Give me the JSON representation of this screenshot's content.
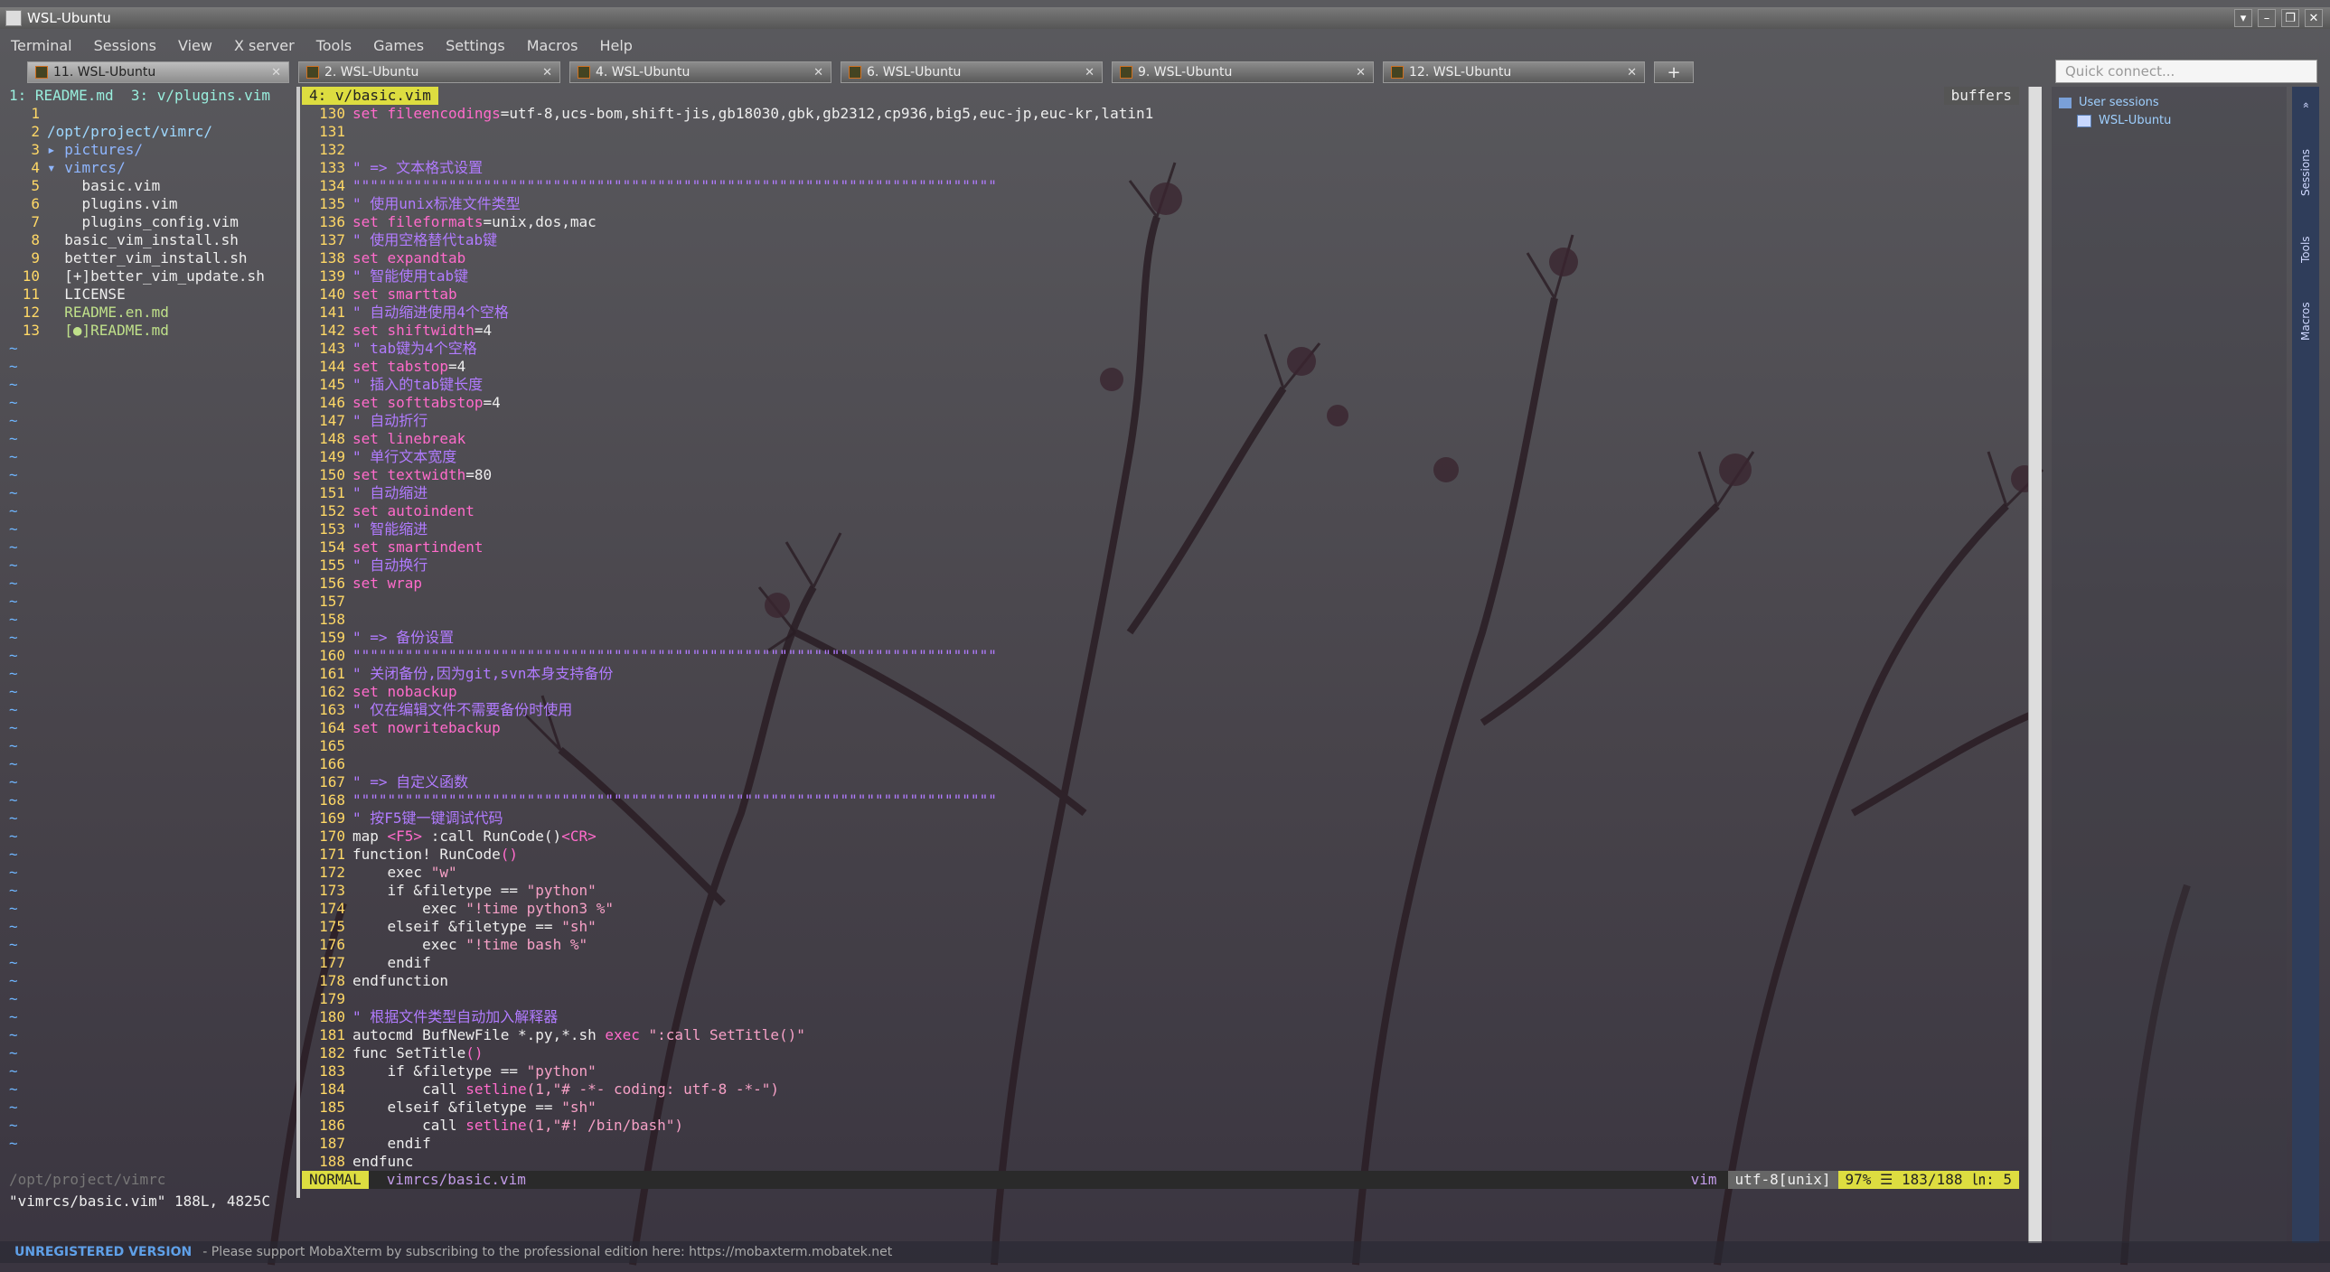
{
  "window": {
    "title": "WSL-Ubuntu",
    "controls": [
      "▾",
      "–",
      "❐",
      "✕"
    ]
  },
  "menu": [
    "Terminal",
    "Sessions",
    "View",
    "X server",
    "Tools",
    "Games",
    "Settings",
    "Macros",
    "Help"
  ],
  "tabs": [
    {
      "label": "11. WSL-Ubuntu",
      "active": true
    },
    {
      "label": "2. WSL-Ubuntu",
      "active": false
    },
    {
      "label": "4. WSL-Ubuntu",
      "active": false
    },
    {
      "label": "6. WSL-Ubuntu",
      "active": false
    },
    {
      "label": "9. WSL-Ubuntu",
      "active": false
    },
    {
      "label": "12. WSL-Ubuntu",
      "active": false
    }
  ],
  "quick_connect": {
    "placeholder": "Quick connect..."
  },
  "sidebar": {
    "section": "User sessions",
    "session": "WSL-Ubuntu",
    "vertical_tabs": [
      "Sessions",
      "Tools",
      "Macros"
    ]
  },
  "vim": {
    "top_buffers": "1: README.md  3: v/plugins.vim",
    "active_buffer": " 4: v/basic.vim ",
    "buffers_label": "buffers",
    "tree": [
      {
        "n": "1",
        "t": "",
        "c": ""
      },
      {
        "n": "2",
        "t": "/opt/project/vimrc/",
        "c": "head"
      },
      {
        "n": "3",
        "t": "▸ pictures/",
        "c": "dir"
      },
      {
        "n": "4",
        "t": "▾ vimrcs/",
        "c": "dir"
      },
      {
        "n": "5",
        "t": "    basic.vim",
        "c": ""
      },
      {
        "n": "6",
        "t": "    plugins.vim",
        "c": ""
      },
      {
        "n": "7",
        "t": "    plugins_config.vim",
        "c": ""
      },
      {
        "n": "8",
        "t": "  basic_vim_install.sh",
        "c": ""
      },
      {
        "n": "9",
        "t": "  better_vim_install.sh",
        "c": ""
      },
      {
        "n": "10",
        "t": "  [+]better_vim_update.sh",
        "c": ""
      },
      {
        "n": "11",
        "t": "  LICENSE",
        "c": ""
      },
      {
        "n": "12",
        "t": "  README.en.md",
        "c": "green"
      },
      {
        "n": "13",
        "t": "  [●]README.md",
        "c": "green"
      }
    ],
    "tree_status": "/opt/project/vimrc",
    "code": [
      {
        "n": "130",
        "s": [
          [
            "kw",
            "set "
          ],
          [
            "opt",
            "fileencodings"
          ],
          [
            "plain",
            "=utf-8,ucs-bom,shift-jis,gb18030,gbk,gb2312,cp936,big5,euc-jp,euc-kr,latin1"
          ]
        ]
      },
      {
        "n": "131",
        "s": []
      },
      {
        "n": "132",
        "s": []
      },
      {
        "n": "133",
        "s": [
          [
            "cm",
            "\" => 文本格式设置"
          ]
        ]
      },
      {
        "n": "134",
        "s": [
          [
            "dq",
            "\"\"\"\"\"\"\"\"\"\"\"\"\"\"\"\"\"\"\"\"\"\"\"\"\"\"\"\"\"\"\"\"\"\"\"\"\"\"\"\"\"\"\"\"\"\"\"\"\"\"\"\"\"\"\"\"\"\"\"\"\"\"\"\"\"\"\"\"\"\"\"\"\"\""
          ]
        ]
      },
      {
        "n": "135",
        "s": [
          [
            "cm",
            "\" 使用unix标准文件类型"
          ]
        ]
      },
      {
        "n": "136",
        "s": [
          [
            "kw",
            "set "
          ],
          [
            "opt",
            "fileformats"
          ],
          [
            "plain",
            "=unix,dos,mac"
          ]
        ]
      },
      {
        "n": "137",
        "s": [
          [
            "cm",
            "\" 使用空格替代tab键"
          ]
        ]
      },
      {
        "n": "138",
        "s": [
          [
            "kw",
            "set "
          ],
          [
            "opt",
            "expandtab"
          ]
        ]
      },
      {
        "n": "139",
        "s": [
          [
            "cm",
            "\" 智能使用tab键"
          ]
        ]
      },
      {
        "n": "140",
        "s": [
          [
            "kw",
            "set "
          ],
          [
            "opt",
            "smarttab"
          ]
        ]
      },
      {
        "n": "141",
        "s": [
          [
            "cm",
            "\" 自动缩进使用4个空格"
          ]
        ]
      },
      {
        "n": "142",
        "s": [
          [
            "kw",
            "set "
          ],
          [
            "opt",
            "shiftwidth"
          ],
          [
            "plain",
            "=4"
          ]
        ]
      },
      {
        "n": "143",
        "s": [
          [
            "cm",
            "\" tab键为4个空格"
          ]
        ]
      },
      {
        "n": "144",
        "s": [
          [
            "kw",
            "set "
          ],
          [
            "opt",
            "tabstop"
          ],
          [
            "plain",
            "=4"
          ]
        ]
      },
      {
        "n": "145",
        "s": [
          [
            "cm",
            "\" 插入的tab键长度"
          ]
        ]
      },
      {
        "n": "146",
        "s": [
          [
            "kw",
            "set "
          ],
          [
            "opt",
            "softtabstop"
          ],
          [
            "plain",
            "=4"
          ]
        ]
      },
      {
        "n": "147",
        "s": [
          [
            "cm",
            "\" 自动折行"
          ]
        ]
      },
      {
        "n": "148",
        "s": [
          [
            "kw",
            "set "
          ],
          [
            "opt",
            "linebreak"
          ]
        ]
      },
      {
        "n": "149",
        "s": [
          [
            "cm",
            "\" 单行文本宽度"
          ]
        ]
      },
      {
        "n": "150",
        "s": [
          [
            "kw",
            "set "
          ],
          [
            "opt",
            "textwidth"
          ],
          [
            "plain",
            "=80"
          ]
        ]
      },
      {
        "n": "151",
        "s": [
          [
            "cm",
            "\" 自动缩进"
          ]
        ]
      },
      {
        "n": "152",
        "s": [
          [
            "kw",
            "set "
          ],
          [
            "opt",
            "autoindent"
          ]
        ]
      },
      {
        "n": "153",
        "s": [
          [
            "cm",
            "\" 智能缩进"
          ]
        ]
      },
      {
        "n": "154",
        "s": [
          [
            "kw",
            "set "
          ],
          [
            "opt",
            "smartindent"
          ]
        ]
      },
      {
        "n": "155",
        "s": [
          [
            "cm",
            "\" 自动换行"
          ]
        ]
      },
      {
        "n": "156",
        "s": [
          [
            "kw",
            "set "
          ],
          [
            "opt",
            "wrap"
          ]
        ]
      },
      {
        "n": "157",
        "s": []
      },
      {
        "n": "158",
        "s": []
      },
      {
        "n": "159",
        "s": [
          [
            "cm",
            "\" => 备份设置"
          ]
        ]
      },
      {
        "n": "160",
        "s": [
          [
            "dq",
            "\"\"\"\"\"\"\"\"\"\"\"\"\"\"\"\"\"\"\"\"\"\"\"\"\"\"\"\"\"\"\"\"\"\"\"\"\"\"\"\"\"\"\"\"\"\"\"\"\"\"\"\"\"\"\"\"\"\"\"\"\"\"\"\"\"\"\"\"\"\"\"\"\"\""
          ]
        ]
      },
      {
        "n": "161",
        "s": [
          [
            "cm",
            "\" 关闭备份,因为git,svn本身支持备份"
          ]
        ]
      },
      {
        "n": "162",
        "s": [
          [
            "kw",
            "set "
          ],
          [
            "opt",
            "nobackup"
          ]
        ]
      },
      {
        "n": "163",
        "s": [
          [
            "cm",
            "\" 仅在编辑文件不需要备份时使用"
          ]
        ]
      },
      {
        "n": "164",
        "s": [
          [
            "kw",
            "set "
          ],
          [
            "opt",
            "nowritebackup"
          ]
        ]
      },
      {
        "n": "165",
        "s": []
      },
      {
        "n": "166",
        "s": []
      },
      {
        "n": "167",
        "s": [
          [
            "cm",
            "\" => 自定义函数"
          ]
        ]
      },
      {
        "n": "168",
        "s": [
          [
            "dq",
            "\"\"\"\"\"\"\"\"\"\"\"\"\"\"\"\"\"\"\"\"\"\"\"\"\"\"\"\"\"\"\"\"\"\"\"\"\"\"\"\"\"\"\"\"\"\"\"\"\"\"\"\"\"\"\"\"\"\"\"\"\"\"\"\"\"\"\"\"\"\"\"\"\"\""
          ]
        ]
      },
      {
        "n": "169",
        "s": [
          [
            "cm",
            "\" 按F5键一键调试代码"
          ]
        ]
      },
      {
        "n": "170",
        "s": [
          [
            "plain",
            "map "
          ],
          [
            "kw",
            "<F5>"
          ],
          [
            "plain",
            " :call RunCode()"
          ],
          [
            "kw",
            "<CR>"
          ]
        ]
      },
      {
        "n": "171",
        "s": [
          [
            "plain",
            "function! RunCode"
          ],
          [
            "kw",
            "()"
          ]
        ]
      },
      {
        "n": "172",
        "s": [
          [
            "plain",
            "    exec "
          ],
          [
            "str",
            "\"w\""
          ]
        ]
      },
      {
        "n": "173",
        "s": [
          [
            "plain",
            "    if &filetype == "
          ],
          [
            "str",
            "\"python\""
          ]
        ]
      },
      {
        "n": "174",
        "s": [
          [
            "plain",
            "        exec "
          ],
          [
            "str",
            "\"!time python3 %\""
          ]
        ]
      },
      {
        "n": "175",
        "s": [
          [
            "plain",
            "    elseif &filetype == "
          ],
          [
            "str",
            "\"sh\""
          ]
        ]
      },
      {
        "n": "176",
        "s": [
          [
            "plain",
            "        exec "
          ],
          [
            "str",
            "\"!time bash %\""
          ]
        ]
      },
      {
        "n": "177",
        "s": [
          [
            "plain",
            "    endif"
          ]
        ]
      },
      {
        "n": "178",
        "s": [
          [
            "plain",
            "endfunction"
          ]
        ]
      },
      {
        "n": "179",
        "s": []
      },
      {
        "n": "180",
        "s": [
          [
            "cm",
            "\" 根据文件类型自动加入解释器"
          ]
        ]
      },
      {
        "n": "181",
        "s": [
          [
            "plain",
            "autocmd BufNewFile *.py,*.sh "
          ],
          [
            "kw",
            "exec "
          ],
          [
            "str",
            "\":call SetTitle()\""
          ]
        ]
      },
      {
        "n": "182",
        "s": [
          [
            "plain",
            "func SetTitle"
          ],
          [
            "kw",
            "()"
          ]
        ]
      },
      {
        "n": "183",
        "s": [
          [
            "plain",
            "    if &filetype == "
          ],
          [
            "str",
            "\"python\""
          ]
        ]
      },
      {
        "n": "184",
        "s": [
          [
            "plain",
            "        call "
          ],
          [
            "kw",
            "setline"
          ],
          [
            "str",
            "(1,\"# -*- coding: utf-8 -*-\")"
          ]
        ]
      },
      {
        "n": "185",
        "s": [
          [
            "plain",
            "    elseif &filetype == "
          ],
          [
            "str",
            "\"sh\""
          ]
        ]
      },
      {
        "n": "186",
        "s": [
          [
            "plain",
            "        call "
          ],
          [
            "kw",
            "setline"
          ],
          [
            "str",
            "(1,\"#! /bin/bash\")"
          ]
        ]
      },
      {
        "n": "187",
        "s": [
          [
            "plain",
            "    endif"
          ]
        ]
      },
      {
        "n": "188",
        "s": [
          [
            "plain",
            "endfunc"
          ]
        ]
      }
    ],
    "status": {
      "mode": "NORMAL",
      "file": "vimrcs/basic.vim",
      "filetype": "vim",
      "encoding": "utf-8[unix]",
      "position": "97% ☰  183/188  ㏑:  5"
    },
    "cmdline": "\"vimrcs/basic.vim\" 188L, 4825C"
  },
  "footer": {
    "unregistered": "UNREGISTERED VERSION",
    "support": "-  Please support MobaXterm by subscribing to the professional edition here:  https://mobaxterm.mobatek.net"
  }
}
